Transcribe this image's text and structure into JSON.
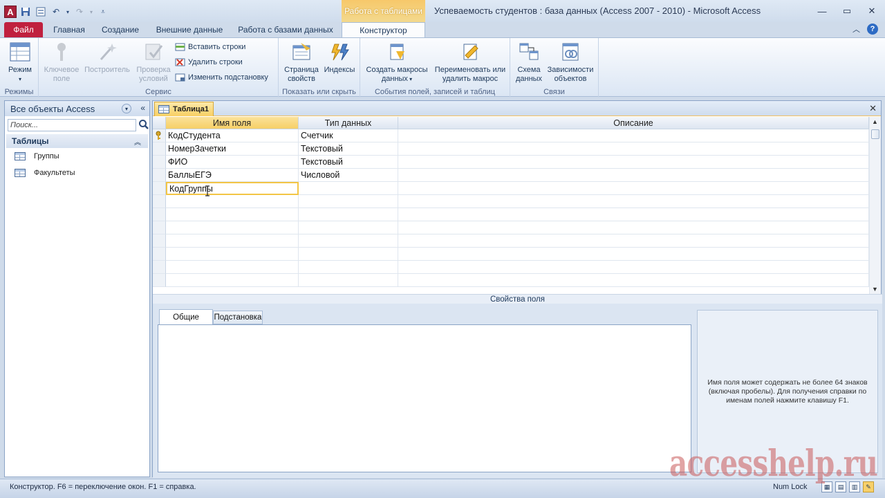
{
  "window": {
    "title": "Успеваемость студентов : база данных (Access 2007 - 2010)  -  Microsoft Access",
    "context_tab_group": "Работа с таблицами",
    "app_icon_letter": "A"
  },
  "tabs": [
    "Файл",
    "Главная",
    "Создание",
    "Внешние данные",
    "Работа с базами данных",
    "Конструктор"
  ],
  "ribbon": {
    "groups": [
      {
        "label": "Режимы"
      },
      {
        "label": "Сервис"
      },
      {
        "label": "Показать или скрыть"
      },
      {
        "label": "События полей, записей и таблиц"
      },
      {
        "label": "Связи"
      }
    ],
    "buttons": {
      "mode": "Режим",
      "primary_key": "Ключевое поле",
      "builder": "Построитель",
      "test_rules": "Проверка условий",
      "insert_rows": "Вставить строки",
      "delete_rows": "Удалить строки",
      "modify_lookups": "Изменить подстановку",
      "property_sheet": "Страница свойств",
      "indexes": "Индексы",
      "create_macros": "Создать макросы данных",
      "rename_macro": "Переименовать или удалить макрос",
      "relationships": "Схема данных",
      "dependencies": "Зависимости объектов"
    }
  },
  "nav": {
    "header": "Все объекты Access",
    "search_placeholder": "Поиск...",
    "section": "Таблицы",
    "items": [
      "Группы",
      "Факультеты"
    ]
  },
  "document": {
    "tab_label": "Таблица1",
    "columns": [
      "Имя поля",
      "Тип данных",
      "Описание"
    ],
    "rows": [
      {
        "name": "КодСтудента",
        "type": "Счетчик",
        "desc": "",
        "key": true
      },
      {
        "name": "НомерЗачетки",
        "type": "Текстовый",
        "desc": ""
      },
      {
        "name": "ФИО",
        "type": "Текстовый",
        "desc": ""
      },
      {
        "name": "БаллыЕГЭ",
        "type": "Числовой",
        "desc": ""
      },
      {
        "name": "КодГруппы",
        "type": "",
        "desc": ""
      }
    ],
    "properties_title": "Свойства поля",
    "property_tabs": [
      "Общие",
      "Подстановка"
    ],
    "help_text": "Имя поля может содержать не более 64 знаков (включая пробелы). Для получения справки по именам полей нажмите клавишу F1."
  },
  "status": {
    "text": "Конструктор.  F6 = переключение окон.  F1 = справка.",
    "numlock": "Num Lock"
  },
  "watermark": "accesshelp.ru",
  "colors": {
    "file_tab": "#c0203e",
    "context_accent": "#f6cf66",
    "ribbon_text": "#1e395b"
  }
}
